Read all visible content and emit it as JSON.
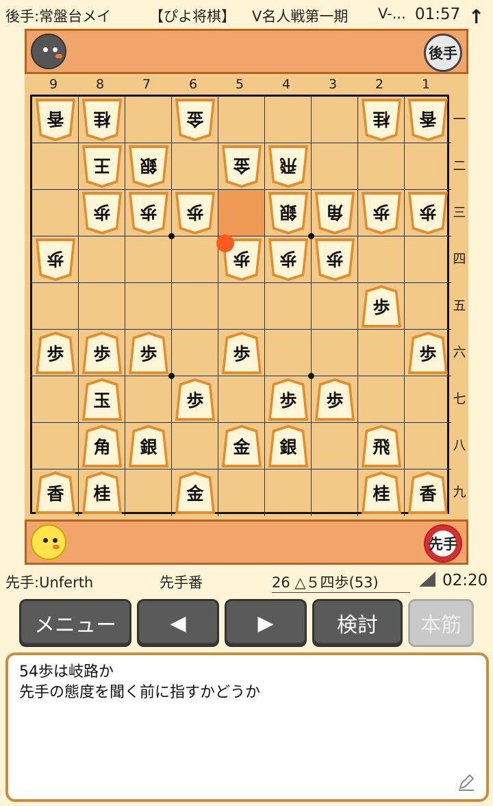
{
  "topbar": {
    "gote_player": "後手:常盤台メイ",
    "app_name": "【ぴよ将棋】",
    "event": "V名人戦第一期",
    "event_more": "V-...",
    "clock": "01:57",
    "arrow": "↑"
  },
  "hands": {
    "gote_badge": "後手",
    "sente_badge": "先手"
  },
  "board": {
    "files": [
      "9",
      "8",
      "7",
      "6",
      "5",
      "4",
      "3",
      "2",
      "1"
    ],
    "ranks": [
      "一",
      "二",
      "三",
      "四",
      "五",
      "六",
      "七",
      "八",
      "九"
    ],
    "last_move": {
      "file": 5,
      "rank": 3
    },
    "move_marker": {
      "file": 5,
      "rank": 4
    },
    "pieces": [
      {
        "file": 9,
        "rank": 1,
        "ch": "香",
        "side": "gote"
      },
      {
        "file": 8,
        "rank": 1,
        "ch": "桂",
        "side": "gote"
      },
      {
        "file": 6,
        "rank": 1,
        "ch": "金",
        "side": "gote"
      },
      {
        "file": 2,
        "rank": 1,
        "ch": "桂",
        "side": "gote"
      },
      {
        "file": 1,
        "rank": 1,
        "ch": "香",
        "side": "gote"
      },
      {
        "file": 8,
        "rank": 2,
        "ch": "王",
        "side": "gote"
      },
      {
        "file": 7,
        "rank": 2,
        "ch": "銀",
        "side": "gote"
      },
      {
        "file": 5,
        "rank": 2,
        "ch": "金",
        "side": "gote"
      },
      {
        "file": 4,
        "rank": 2,
        "ch": "飛",
        "side": "gote"
      },
      {
        "file": 8,
        "rank": 3,
        "ch": "歩",
        "side": "gote"
      },
      {
        "file": 7,
        "rank": 3,
        "ch": "歩",
        "side": "gote"
      },
      {
        "file": 6,
        "rank": 3,
        "ch": "歩",
        "side": "gote"
      },
      {
        "file": 4,
        "rank": 3,
        "ch": "銀",
        "side": "gote"
      },
      {
        "file": 3,
        "rank": 3,
        "ch": "角",
        "side": "gote"
      },
      {
        "file": 2,
        "rank": 3,
        "ch": "歩",
        "side": "gote"
      },
      {
        "file": 1,
        "rank": 3,
        "ch": "歩",
        "side": "gote"
      },
      {
        "file": 9,
        "rank": 4,
        "ch": "歩",
        "side": "gote"
      },
      {
        "file": 5,
        "rank": 4,
        "ch": "歩",
        "side": "gote"
      },
      {
        "file": 4,
        "rank": 4,
        "ch": "歩",
        "side": "gote"
      },
      {
        "file": 3,
        "rank": 4,
        "ch": "歩",
        "side": "gote"
      },
      {
        "file": 2,
        "rank": 5,
        "ch": "歩",
        "side": "sente"
      },
      {
        "file": 9,
        "rank": 6,
        "ch": "歩",
        "side": "sente"
      },
      {
        "file": 8,
        "rank": 6,
        "ch": "歩",
        "side": "sente"
      },
      {
        "file": 7,
        "rank": 6,
        "ch": "歩",
        "side": "sente"
      },
      {
        "file": 5,
        "rank": 6,
        "ch": "歩",
        "side": "sente"
      },
      {
        "file": 1,
        "rank": 6,
        "ch": "歩",
        "side": "sente"
      },
      {
        "file": 8,
        "rank": 7,
        "ch": "玉",
        "side": "sente"
      },
      {
        "file": 6,
        "rank": 7,
        "ch": "歩",
        "side": "sente"
      },
      {
        "file": 4,
        "rank": 7,
        "ch": "歩",
        "side": "sente"
      },
      {
        "file": 3,
        "rank": 7,
        "ch": "歩",
        "side": "sente"
      },
      {
        "file": 8,
        "rank": 8,
        "ch": "角",
        "side": "sente"
      },
      {
        "file": 7,
        "rank": 8,
        "ch": "銀",
        "side": "sente"
      },
      {
        "file": 5,
        "rank": 8,
        "ch": "金",
        "side": "sente"
      },
      {
        "file": 4,
        "rank": 8,
        "ch": "銀",
        "side": "sente"
      },
      {
        "file": 2,
        "rank": 8,
        "ch": "飛",
        "side": "sente"
      },
      {
        "file": 9,
        "rank": 9,
        "ch": "香",
        "side": "sente"
      },
      {
        "file": 8,
        "rank": 9,
        "ch": "桂",
        "side": "sente"
      },
      {
        "file": 6,
        "rank": 9,
        "ch": "金",
        "side": "sente"
      },
      {
        "file": 2,
        "rank": 9,
        "ch": "桂",
        "side": "sente"
      },
      {
        "file": 1,
        "rank": 9,
        "ch": "香",
        "side": "sente"
      }
    ]
  },
  "status": {
    "sente_player": "先手:Unferth",
    "turn": "先手番",
    "move": "26 △５四歩(53)",
    "clock": "02:20"
  },
  "buttons": {
    "menu": "メニュー",
    "prev": "◀",
    "next": "▶",
    "analyze": "検討",
    "mainline": "本筋"
  },
  "comment": {
    "line1": "54歩は岐路か",
    "line2": "先手の態度を聞く前に指すかどうか"
  }
}
